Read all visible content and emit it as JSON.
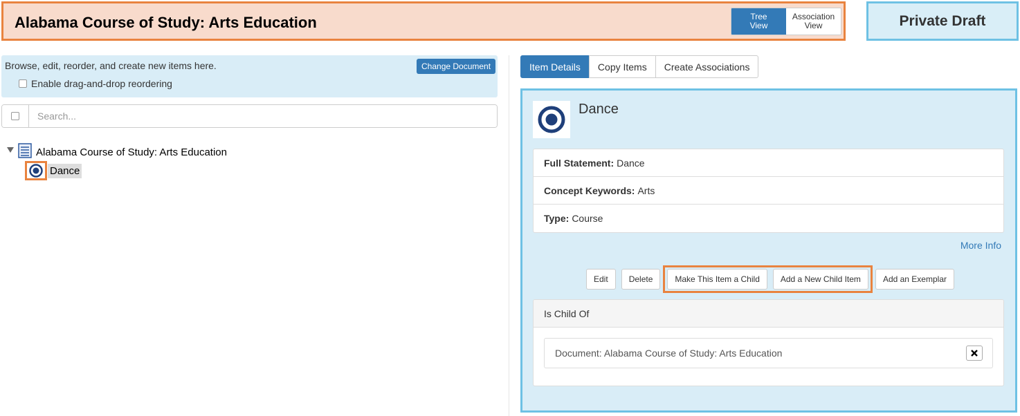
{
  "header": {
    "title": "Alabama Course of Study: Arts Education",
    "view_toggle": {
      "tree_label": "Tree\nView",
      "association_label": "Association\nView",
      "active": "tree"
    },
    "status": "Private Draft"
  },
  "left_panel": {
    "info_text": "Browse, edit, reorder, and create new items here.",
    "change_document_label": "Change Document",
    "drag_drop_label": "Enable drag-and-drop reordering",
    "search_placeholder": "Search...",
    "tree": {
      "root_label": "Alabama Course of Study: Arts Education",
      "root_icon": "document-icon",
      "children": [
        {
          "label": "Dance",
          "icon": "target-icon",
          "selected": true
        }
      ]
    }
  },
  "right_panel": {
    "tabs": [
      {
        "label": "Item Details",
        "active": true
      },
      {
        "label": "Copy Items",
        "active": false
      },
      {
        "label": "Create Associations",
        "active": false
      }
    ],
    "item": {
      "title": "Dance",
      "icon": "target-icon",
      "properties": [
        {
          "label": "Full Statement:",
          "value": "Dance"
        },
        {
          "label": "Concept Keywords:",
          "value": "Arts"
        },
        {
          "label": "Type:",
          "value": "Course"
        }
      ],
      "more_info_label": "More Info"
    },
    "actions": {
      "edit": "Edit",
      "delete": "Delete",
      "make_child": "Make This Item a Child",
      "add_child": "Add a New Child Item",
      "add_exemplar": "Add an Exemplar"
    },
    "is_child_of": {
      "heading": "Is Child Of",
      "items": [
        {
          "label": "Document: Alabama Course of Study: Arts Education"
        }
      ]
    }
  },
  "colors": {
    "accent_blue": "#337ab7",
    "highlight_orange": "#e9833f",
    "panel_blue": "#d9edf7",
    "header_peach": "#f8dbcc"
  }
}
